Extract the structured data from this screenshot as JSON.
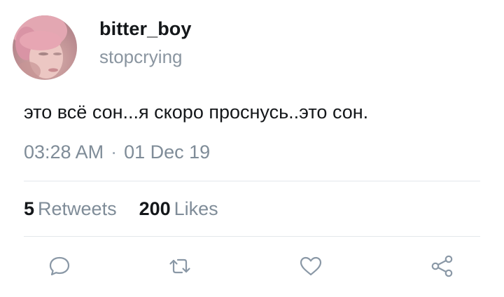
{
  "author": {
    "display_name": "bitter_boy",
    "handle": "stopcrying"
  },
  "tweet": {
    "text": "это всё сон...я скоро проснусь..это сон.",
    "time": "03:28 AM",
    "separator": "·",
    "date": "01 Dec 19"
  },
  "stats": {
    "retweets_count": "5",
    "retweets_label": "Retweets",
    "likes_count": "200",
    "likes_label": "Likes"
  },
  "actions": {
    "reply_icon": "reply-icon",
    "retweet_icon": "retweet-icon",
    "like_icon": "heart-icon",
    "share_icon": "share-icon"
  },
  "colors": {
    "text_primary": "#14171a",
    "text_secondary": "#7f8c98",
    "icon": "#8a98a6",
    "divider": "#e3e7eb"
  }
}
